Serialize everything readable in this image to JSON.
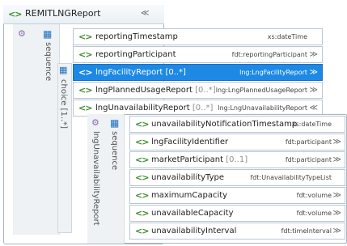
{
  "outer": {
    "title": "REMITLNGReport",
    "sequence_label": "sequence",
    "choice_label": "choice [1..*]"
  },
  "rows": [
    {
      "name": "reportingTimestamp",
      "card": "",
      "type": "xs:dateTime",
      "chev": ""
    },
    {
      "name": "reportingParticipant",
      "card": "",
      "type": "fdt:reportingParticipant",
      "chev": "≫"
    },
    {
      "name": "lngFacilityReport",
      "card": "[0..*]",
      "type": "lng:LngFacilityReport",
      "chev": "≫"
    },
    {
      "name": "lngPlannedUsageReport",
      "card": "[0..*]",
      "type": "lng:LngPlannedUsageReport",
      "chev": "≫"
    },
    {
      "name": "lngUnavailabilityReport",
      "card": "[0..*]",
      "type": "lng:LngUnavailabilityReport",
      "chev": "≪"
    }
  ],
  "detail": {
    "title": "lngUnavailabilityReport",
    "sequence_label": "sequence",
    "rows": [
      {
        "name": "unavailabilityNotificationTimestamp",
        "card": "",
        "type": "xs:dateTime",
        "chev": ""
      },
      {
        "name": "lngFacilityIdentifier",
        "card": "",
        "type": "fdt:participant",
        "chev": "≫"
      },
      {
        "name": "marketParticipant",
        "card": "[0..1]",
        "type": "fdt:participant",
        "chev": "≫"
      },
      {
        "name": "unavailabilityType",
        "card": "",
        "type": "fdt:UnavailabilityTypeList",
        "chev": ""
      },
      {
        "name": "maximumCapacity",
        "card": "",
        "type": "fdt:volume",
        "chev": "≫"
      },
      {
        "name": "unavailableCapacity",
        "card": "",
        "type": "fdt:volume",
        "chev": "≫"
      },
      {
        "name": "unavailabilityInterval",
        "card": "",
        "type": "fdt:timeInterval",
        "chev": "≫"
      }
    ]
  },
  "colors": {
    "selected": "#1d89e4",
    "tag_icon": "#3d8a2c",
    "border": "#b9c6d2"
  }
}
